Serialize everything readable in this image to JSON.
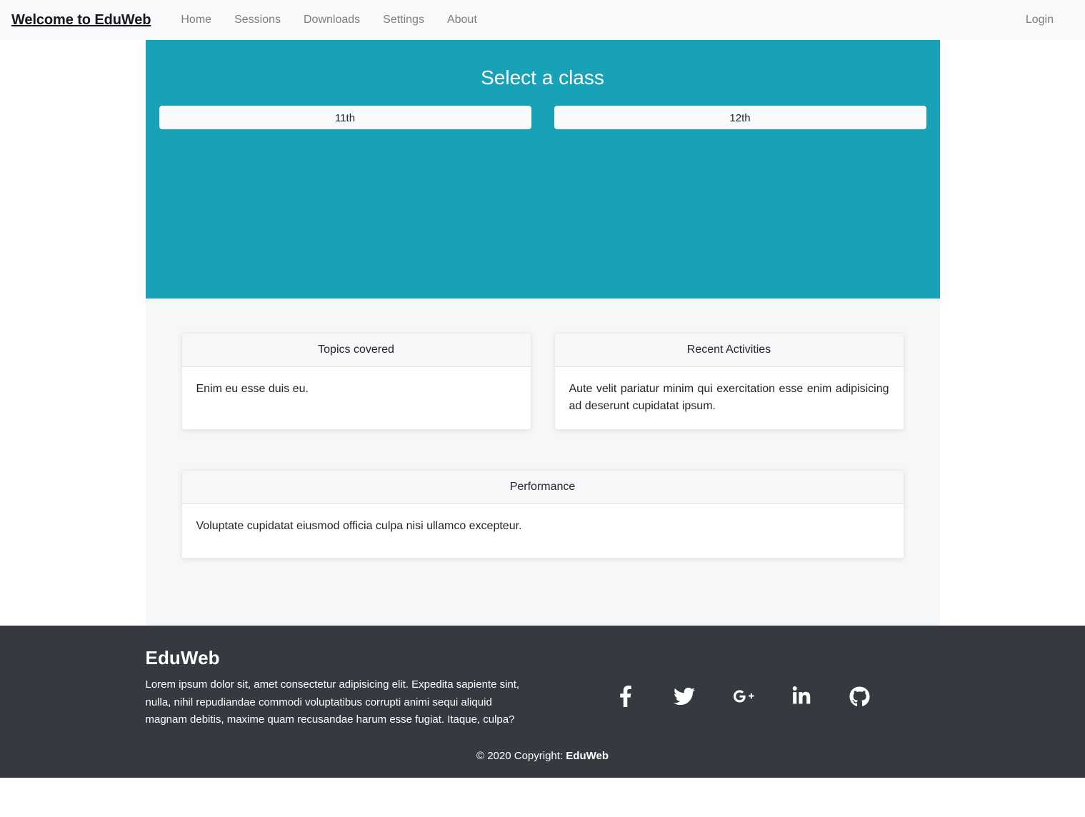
{
  "navbar": {
    "brand": "Welcome to EduWeb",
    "links": [
      {
        "label": "Home"
      },
      {
        "label": "Sessions"
      },
      {
        "label": "Downloads"
      },
      {
        "label": "Settings"
      },
      {
        "label": "About"
      }
    ],
    "right_link": "Login",
    "background": "#f8f9fa"
  },
  "hero": {
    "title": "Select a class",
    "background": "#17a2b8",
    "buttons": [
      {
        "label": "11th"
      },
      {
        "label": "12th"
      }
    ]
  },
  "cards": [
    {
      "title": "Topics covered",
      "body": "Enim eu esse duis eu."
    },
    {
      "title": "Recent Activities",
      "body": "Aute velit pariatur minim qui exercitation esse enim adipisicing ad deserunt cupidatat ipsum."
    },
    {
      "title": "Performance",
      "body": "Voluptate cupidatat eiusmod officia culpa nisi ullamco excepteur."
    }
  ],
  "footer": {
    "title": "EduWeb",
    "text": "Lorem ipsum dolor sit, amet consectetur adipisicing elit. Expedita sapiente sint, nulla, nihil repudiandae commodi voluptatibus corrupti animi sequi aliquid magnam debitis, maxime quam recusandae harum esse fugiat. Itaque, culpa?",
    "background": "#343a40",
    "social": [
      {
        "name": "facebook-icon"
      },
      {
        "name": "twitter-icon"
      },
      {
        "name": "google-plus-icon"
      },
      {
        "name": "linkedin-icon"
      },
      {
        "name": "github-icon"
      }
    ],
    "copyright_prefix": "© 2020 Copyright: ",
    "copyright_brand": "EduWeb"
  }
}
